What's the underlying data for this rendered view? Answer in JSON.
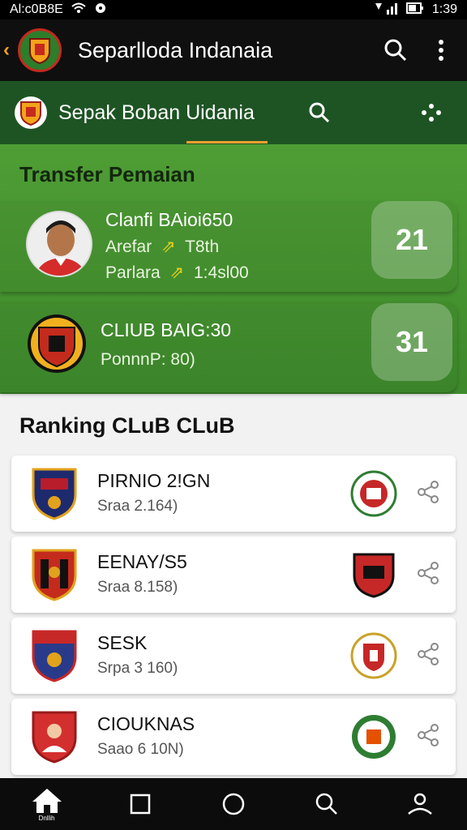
{
  "status": {
    "left": "Al:c0B8E",
    "time": "1:39"
  },
  "app": {
    "title": "Separlloda Indanaia"
  },
  "subheader": {
    "title": "Sepak Boban Uidania"
  },
  "transfer": {
    "title": "Transfer Pemaian",
    "cards": [
      {
        "name": "Clanfi BAioi650",
        "line1": "Arefar",
        "line1b": "T8th",
        "line2": "Parlara",
        "line2b": "1:4sl00",
        "count": "21"
      },
      {
        "name": "CLIUB BAIG:30",
        "line1": "PonnnP: 80)",
        "count": "31"
      }
    ]
  },
  "ranking": {
    "title": "Ranking CLuB CLuB",
    "rows": [
      {
        "name": "PIRNIO 2!GN",
        "sub": "Sraa 2.164)"
      },
      {
        "name": "EENAY/S5",
        "sub": "Sraa 8.158)"
      },
      {
        "name": "SESK",
        "sub": "Srpa 3 160)"
      },
      {
        "name": "CIOUKNAS",
        "sub": "Saao 6 10N)"
      }
    ]
  },
  "nav": {
    "home_label": "Dnllih"
  },
  "colors": {
    "primary_green": "#4f9d35",
    "dark_green": "#1e5424",
    "accent": "#f0a030"
  }
}
